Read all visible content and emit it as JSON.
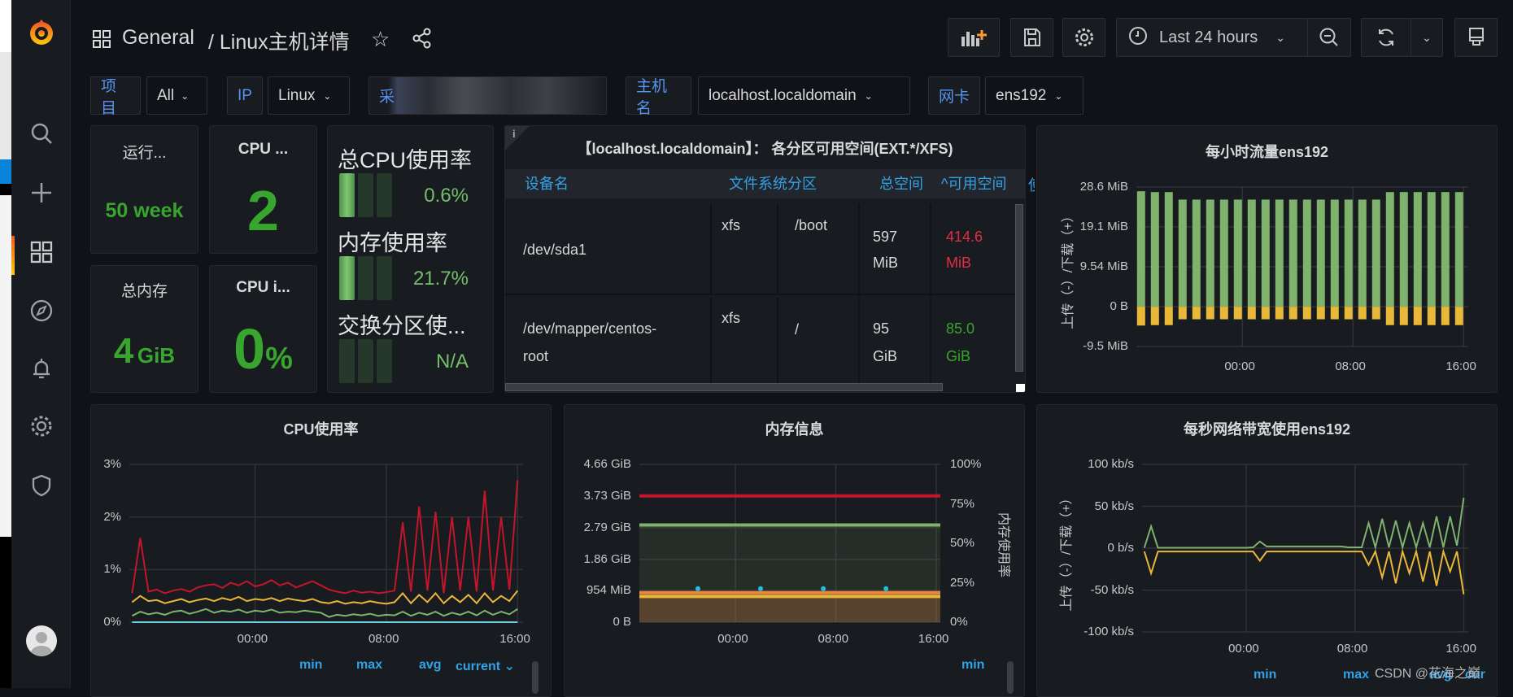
{
  "header": {
    "breadcrumb_root": "General",
    "breadcrumb_page": "/ Linux主机详情",
    "time_range": "Last 24 hours"
  },
  "variables": [
    {
      "label": "项目",
      "value": "All"
    },
    {
      "label": "IP",
      "value": "Linux"
    },
    {
      "label": "采",
      "value": ""
    },
    {
      "label": "主机名",
      "value": "localhost.localdomain"
    },
    {
      "label": "网卡",
      "value": "ens192"
    }
  ],
  "stats": {
    "uptime": {
      "title": "运行...",
      "value": "50 week"
    },
    "cpu_cores": {
      "title": "CPU ...",
      "value": "2"
    },
    "total_mem": {
      "title": "总内存",
      "value": "4",
      "unit": "GiB"
    },
    "cpu_iowait": {
      "title": "CPU i...",
      "value": "0",
      "unit": "%"
    }
  },
  "gauges": [
    {
      "title": "总CPU使用率",
      "value": "0.6%",
      "level": 0.006
    },
    {
      "title": "内存使用率",
      "value": "21.7%",
      "level": 0.217
    },
    {
      "title": "交换分区使...",
      "value": "N/A",
      "level": 0
    }
  ],
  "table": {
    "title": "【localhost.localdomain】： 各分区可用空间(EXT.*/XFS)",
    "columns": [
      "设备名",
      "文件系统分区",
      "总空间",
      "^可用空间",
      "使"
    ],
    "rows": [
      {
        "device": "/dev/sda1",
        "fs": "xfs",
        "mount": "/boot",
        "total": [
          "597",
          "MiB"
        ],
        "avail": [
          "414.6",
          "MiB"
        ],
        "avail_color": "#e02f44"
      },
      {
        "device": [
          "/dev/mapper/centos-",
          "root"
        ],
        "fs": "xfs",
        "mount": "/",
        "total": [
          "95",
          "GiB"
        ],
        "avail": [
          "85.0",
          "GiB"
        ],
        "avail_color": "#37a52e"
      }
    ]
  },
  "legends": {
    "cpu": [
      "min",
      "max",
      "avg",
      "current ⌄"
    ],
    "mem": [
      "min"
    ],
    "net": [
      "min",
      "max",
      "avg",
      "cur"
    ]
  },
  "watermark": "CSDN @花海之巅",
  "chart_data": [
    {
      "type": "bar",
      "title": "每小时流量ens192",
      "ylabel": "上传（-）/下载（+）",
      "ylim": [
        -9.5,
        28.6
      ],
      "y_ticks": {
        "values": [
          28.6,
          19.1,
          9.54,
          0,
          -9.5
        ],
        "labels": [
          "28.6 MiB",
          "19.1 MiB",
          "9.54 MiB",
          "0 B",
          "-9.5 MiB"
        ]
      },
      "xlim": [
        "16:20",
        "16:20"
      ],
      "x_ticks": [
        "00:00",
        "08:00",
        "16:00"
      ],
      "grid": true,
      "x": [
        "16:00",
        "17:00",
        "18:00",
        "19:00",
        "20:00",
        "21:00",
        "22:00",
        "23:00",
        "00:00",
        "01:00",
        "02:00",
        "03:00",
        "04:00",
        "05:00",
        "06:00",
        "07:00",
        "08:00",
        "09:00",
        "10:00",
        "11:00",
        "12:00",
        "13:00",
        "14:00",
        "15:00",
        "16:00"
      ],
      "series": [
        {
          "color": "#7eb26d",
          "values": [
            27.6,
            27.4,
            27.4,
            25.6,
            25.6,
            25.6,
            25.6,
            25.6,
            25.6,
            25.6,
            25.6,
            25.6,
            25.6,
            25.6,
            25.6,
            25.6,
            25.6,
            25.6,
            27.4,
            27.4,
            27.4,
            27.4,
            27.4,
            27.4,
            27.6
          ]
        },
        {
          "color": "#eab839",
          "values": [
            -4.5,
            -4.4,
            -4.4,
            -3.0,
            -3.0,
            -3.0,
            -3.0,
            -3.0,
            -3.0,
            -3.0,
            -3.0,
            -3.0,
            -3.0,
            -3.0,
            -3.0,
            -3.0,
            -3.0,
            -3.0,
            -4.4,
            -4.4,
            -4.4,
            -4.4,
            -4.4,
            -4.4,
            -4.5
          ]
        }
      ]
    },
    {
      "type": "line",
      "title": "CPU使用率",
      "ylim": [
        0,
        3
      ],
      "y_ticks": {
        "values": [
          0,
          1,
          2,
          3
        ],
        "labels": [
          "0%",
          "1%",
          "2%",
          "3%"
        ]
      },
      "xlim": [
        "16:20",
        "16:20"
      ],
      "x_ticks": [
        "00:00",
        "08:00",
        "16:00"
      ],
      "grid": true,
      "x": [
        "16:30",
        "17:00",
        "17:30",
        "18:00",
        "18:30",
        "19:00",
        "19:30",
        "20:00",
        "20:30",
        "21:00",
        "21:30",
        "22:00",
        "22:30",
        "23:00",
        "23:30",
        "00:00",
        "00:30",
        "01:00",
        "01:30",
        "02:00",
        "02:30",
        "03:00",
        "03:30",
        "04:00",
        "04:30",
        "05:00",
        "05:30",
        "06:00",
        "06:30",
        "07:00",
        "07:30",
        "08:00",
        "08:30",
        "09:00",
        "09:30",
        "10:00",
        "10:30",
        "11:00",
        "11:30",
        "12:00",
        "12:30",
        "13:00",
        "13:30",
        "14:00",
        "14:30",
        "15:00",
        "15:30",
        "16:00"
      ],
      "series": [
        {
          "color": "#c4162a",
          "values": [
            0.55,
            1.6,
            0.58,
            0.62,
            0.55,
            0.6,
            0.63,
            0.58,
            0.66,
            0.7,
            0.72,
            0.65,
            0.75,
            0.7,
            0.78,
            0.68,
            0.72,
            0.8,
            0.7,
            0.75,
            0.66,
            0.72,
            0.78,
            0.7,
            0.62,
            0.58,
            0.55,
            0.6,
            0.56,
            0.58,
            0.55,
            0.57,
            0.6,
            1.9,
            0.58,
            2.2,
            0.6,
            2.1,
            0.55,
            2.0,
            0.6,
            2.0,
            0.58,
            2.5,
            0.6,
            2.0,
            0.62,
            2.7
          ]
        },
        {
          "color": "#eab839",
          "values": [
            0.38,
            0.5,
            0.4,
            0.42,
            0.36,
            0.4,
            0.44,
            0.38,
            0.42,
            0.45,
            0.4,
            0.46,
            0.42,
            0.48,
            0.4,
            0.44,
            0.42,
            0.46,
            0.4,
            0.45,
            0.42,
            0.4,
            0.44,
            0.38,
            0.36,
            0.4,
            0.35,
            0.38,
            0.36,
            0.4,
            0.37,
            0.35,
            0.38,
            0.55,
            0.36,
            0.52,
            0.38,
            0.55,
            0.36,
            0.5,
            0.38,
            0.52,
            0.36,
            0.55,
            0.38,
            0.5,
            0.4,
            0.6
          ]
        },
        {
          "color": "#7eb26d",
          "values": [
            0.12,
            0.2,
            0.15,
            0.18,
            0.14,
            0.2,
            0.22,
            0.16,
            0.2,
            0.25,
            0.18,
            0.22,
            0.2,
            0.24,
            0.18,
            0.22,
            0.2,
            0.24,
            0.18,
            0.2,
            0.19,
            0.22,
            0.2,
            0.18,
            0.1,
            0.14,
            0.12,
            0.15,
            0.13,
            0.16,
            0.12,
            0.14,
            0.13,
            0.2,
            0.12,
            0.18,
            0.14,
            0.2,
            0.12,
            0.18,
            0.14,
            0.2,
            0.13,
            0.22,
            0.14,
            0.2,
            0.15,
            0.25
          ]
        },
        {
          "color": "#6ed0e0",
          "values": [
            0,
            0,
            0,
            0,
            0,
            0,
            0,
            0,
            0,
            0,
            0,
            0,
            0,
            0,
            0,
            0,
            0,
            0,
            0,
            0,
            0,
            0,
            0,
            0,
            0,
            0,
            0,
            0,
            0,
            0,
            0,
            0,
            0,
            0,
            0,
            0,
            0,
            0,
            0,
            0,
            0,
            0,
            0,
            0,
            0,
            0,
            0,
            0
          ]
        }
      ]
    },
    {
      "type": "line",
      "title": "内存信息",
      "ylabel_right": "内存使用率",
      "ylim": [
        0,
        4.66
      ],
      "y_ticks": {
        "values": [
          0,
          0.932,
          1.86,
          2.79,
          3.73,
          4.66
        ],
        "labels": [
          "0 B",
          "954 MiB",
          "1.86 GiB",
          "2.79 GiB",
          "3.73 GiB",
          "4.66 GiB"
        ]
      },
      "y2_ticks": {
        "labels": [
          "0%",
          "25%",
          "50%",
          "75%",
          "100%"
        ],
        "ylim": [
          0,
          100
        ],
        "values": [
          0,
          25,
          50,
          75,
          100
        ]
      },
      "xlim": [
        "16:20",
        "16:20"
      ],
      "x_ticks": [
        "00:00",
        "08:00",
        "16:00"
      ],
      "grid": true,
      "series": [
        {
          "color": "#c4162a",
          "x": [
            "16:20",
            "16:20"
          ],
          "values": [
            3.73,
            3.73
          ]
        },
        {
          "color": "#7eb26d",
          "x": [
            "16:20",
            "16:20"
          ],
          "values": [
            2.87,
            2.87
          ],
          "fill": true
        },
        {
          "color": "#ef843c",
          "x": [
            "16:20",
            "16:20"
          ],
          "values": [
            0.87,
            0.87
          ],
          "fill": true
        },
        {
          "color": "#eab839",
          "x": [
            "16:20",
            "16:20"
          ],
          "values": [
            0.76,
            0.76
          ]
        },
        {
          "color": "#1ac3e6",
          "x": [
            "21:00",
            "02:00",
            "07:00",
            "12:00"
          ],
          "values": [
            0.99,
            0.99,
            0.99,
            0.99
          ],
          "points": true
        }
      ]
    },
    {
      "type": "line",
      "title": "每秒网络带宽使用ens192",
      "ylabel": "上传（-）/下载（+）",
      "ylim": [
        -100,
        100
      ],
      "y_ticks": {
        "values": [
          100,
          50,
          0,
          -50,
          -100
        ],
        "labels": [
          "100 kb/s",
          "50 kb/s",
          "0 b/s",
          "-50 kb/s",
          "-100 kb/s"
        ]
      },
      "xlim": [
        "16:20",
        "16:20"
      ],
      "x_ticks": [
        "00:00",
        "08:00",
        "16:00"
      ],
      "grid": true,
      "x": [
        "16:30",
        "17:00",
        "17:30",
        "18:00",
        "18:30",
        "19:00",
        "19:30",
        "20:00",
        "20:30",
        "21:00",
        "21:30",
        "22:00",
        "22:30",
        "23:00",
        "23:30",
        "00:00",
        "00:30",
        "01:00",
        "01:30",
        "02:00",
        "02:30",
        "03:00",
        "03:30",
        "04:00",
        "04:30",
        "05:00",
        "05:30",
        "06:00",
        "06:30",
        "07:00",
        "07:30",
        "08:00",
        "08:30",
        "09:00",
        "09:30",
        "10:00",
        "10:30",
        "11:00",
        "11:30",
        "12:00",
        "12:30",
        "13:00",
        "13:30",
        "14:00",
        "14:30",
        "15:00",
        "15:30",
        "16:00"
      ],
      "series": [
        {
          "color": "#7eb26d",
          "values": [
            0.5,
            26,
            0.5,
            0.5,
            0.5,
            0.5,
            0.5,
            0.5,
            0.5,
            0.5,
            0.5,
            0.5,
            0.5,
            0.5,
            0.5,
            0.5,
            1,
            8,
            2,
            2,
            2,
            2,
            2,
            2,
            2,
            2,
            2,
            2,
            2,
            2,
            1,
            1,
            1,
            30,
            1,
            35,
            1,
            33,
            1,
            30,
            1,
            30,
            1,
            38,
            1,
            38,
            3,
            60
          ]
        },
        {
          "color": "#eab839",
          "values": [
            -4,
            -30,
            -4,
            -4,
            -4,
            -4,
            -4,
            -4,
            -4,
            -4,
            -4,
            -4,
            -4,
            -4,
            -4,
            -4,
            -4,
            -15,
            -4,
            -4,
            -4,
            -4,
            -4,
            -4,
            -4,
            -4,
            -4,
            -4,
            -4,
            -4,
            -4,
            -4,
            -4,
            -20,
            -4,
            -35,
            -4,
            -42,
            -4,
            -30,
            -4,
            -40,
            -4,
            -45,
            -4,
            -28,
            -4,
            -55
          ]
        }
      ]
    }
  ]
}
